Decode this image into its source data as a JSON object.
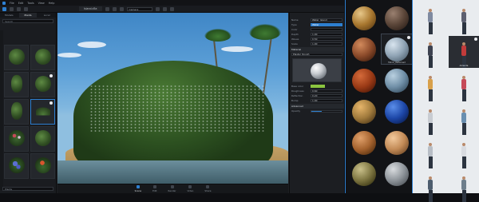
{
  "menubar": {
    "items": [
      "File",
      "Edit",
      "Tools",
      "View",
      "Help"
    ]
  },
  "toolbar": {
    "document_tab": "Island.d5a",
    "combo_value": "Camera"
  },
  "library": {
    "tabs": [
      "Models",
      "Plants",
      "Local"
    ],
    "search_placeholder": "Search",
    "footer_value": "Plants"
  },
  "viewport": {
    "modes": [
      {
        "label": "Scene",
        "active": true
      },
      {
        "label": "Edit",
        "active": false
      },
      {
        "label": "Render",
        "active": false
      },
      {
        "label": "Video",
        "active": false
      },
      {
        "label": "Share",
        "active": false
      }
    ]
  },
  "properties": {
    "rows1": [
      {
        "label": "Name",
        "value": "Water_Island",
        "blue": false
      },
      {
        "label": "Type",
        "value": "Water",
        "blue": true
      },
      {
        "label": "Color",
        "value": "",
        "blue": false
      },
      {
        "label": "Depth",
        "value": "1.00",
        "blue": false
      },
      {
        "label": "Waves",
        "value": "0.50",
        "blue": false
      },
      {
        "label": "Scale",
        "value": "1.00",
        "blue": false
      }
    ],
    "section_material": "Material",
    "material_name": "Plaster_Rough",
    "rows2": [
      {
        "label": "Base color",
        "value": ""
      },
      {
        "label": "Roughness",
        "value": "0.60"
      },
      {
        "label": "Reflection",
        "value": "0.20"
      },
      {
        "label": "Bump",
        "value": "1.00"
      }
    ],
    "section_advanced": "Advanced",
    "slider_label": "Opacity",
    "slider_value": 0.35
  },
  "materials": {
    "items": [
      {
        "name": "",
        "colors": [
          "#e7c789",
          "#a8772f",
          "#5c3b13"
        ]
      },
      {
        "name": "",
        "colors": [
          "#9a8070",
          "#5a4538",
          "#2a1e18"
        ]
      },
      {
        "name": "",
        "colors": [
          "#d28a5c",
          "#8b4a2a",
          "#3d1c0d"
        ]
      },
      {
        "name": "Fabric_Patterned",
        "colors": [
          "#d8e4ee",
          "#8fa3b4",
          "#4c5d6c"
        ],
        "selected": true,
        "badge": true
      },
      {
        "name": "",
        "colors": [
          "#d46a3a",
          "#9a3a16",
          "#4a1606"
        ]
      },
      {
        "name": "",
        "colors": [
          "#b9d0e0",
          "#6f8ea6",
          "#31485a"
        ]
      },
      {
        "name": "",
        "colors": [
          "#e6b56a",
          "#a07a3c",
          "#4a3416"
        ]
      },
      {
        "name": "",
        "colors": [
          "#5a8de8",
          "#1d47a8",
          "#081b4c"
        ]
      },
      {
        "name": "",
        "colors": [
          "#e0a06a",
          "#a4622e",
          "#4e2a0c"
        ]
      },
      {
        "name": "",
        "colors": [
          "#f2c99c",
          "#c28a56",
          "#6b4524"
        ]
      },
      {
        "name": "",
        "colors": [
          "#c9c08a",
          "#7c7440",
          "#34300f"
        ]
      },
      {
        "name": "",
        "colors": [
          "#d9dcdf",
          "#8d9399",
          "#4a4f55"
        ]
      }
    ]
  },
  "people": {
    "items": [
      {
        "name": "",
        "body": "#7f8aa0",
        "selected": false
      },
      {
        "name": "",
        "body": "#5d6070",
        "selected": false
      },
      {
        "name": "",
        "body": "#3d4250",
        "selected": false
      },
      {
        "name": "Amanda",
        "body": "#c23b3b",
        "selected": true
      },
      {
        "name": "",
        "body": "#d8a04a",
        "selected": false
      },
      {
        "name": "",
        "body": "#c64a58",
        "selected": false
      },
      {
        "name": "",
        "body": "#c8ccd2",
        "selected": false
      },
      {
        "name": "",
        "body": "#6a8fb0",
        "selected": false
      },
      {
        "name": "",
        "body": "#b8bec6",
        "selected": false
      },
      {
        "name": "",
        "body": "#d8dbe0",
        "selected": false
      },
      {
        "name": "",
        "body": "#4d5d6e",
        "selected": false
      },
      {
        "name": "",
        "body": "#6e7e8c",
        "selected": false
      }
    ]
  },
  "colors": {
    "accent": "#2d7fd0",
    "accent_green": "#8bc53f"
  }
}
